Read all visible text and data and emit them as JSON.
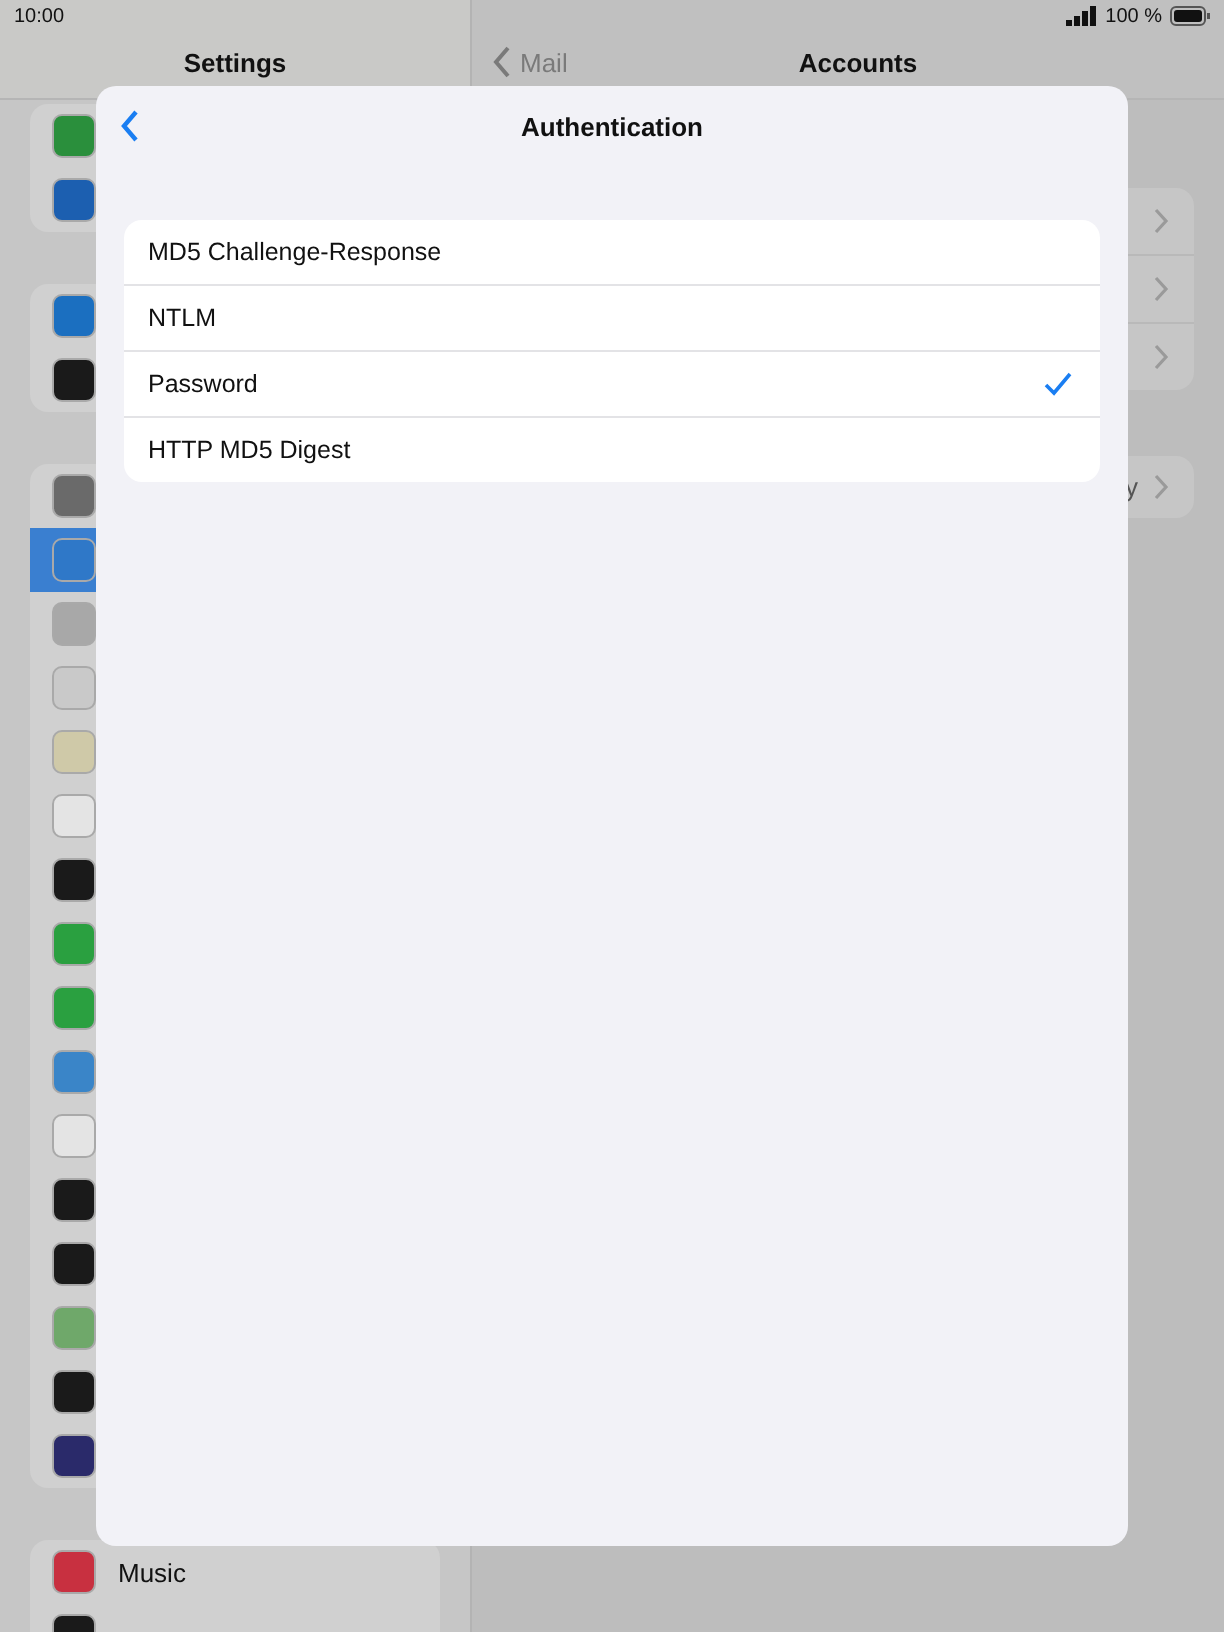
{
  "status_bar": {
    "time": "10:00",
    "battery": "100 %"
  },
  "sidebar": {
    "title": "Settings",
    "groups": [
      {
        "items": [
          {
            "selected": false
          },
          {
            "selected": false
          }
        ]
      },
      {
        "items": [
          {
            "selected": false
          },
          {
            "selected": false
          }
        ]
      },
      {
        "items": [
          {
            "selected": false
          },
          {
            "selected": true
          },
          {
            "selected": false
          },
          {
            "selected": false
          },
          {
            "selected": false
          },
          {
            "selected": false
          },
          {
            "selected": false
          },
          {
            "selected": false
          },
          {
            "selected": false
          },
          {
            "selected": false
          },
          {
            "selected": false
          },
          {
            "selected": false
          },
          {
            "selected": false
          },
          {
            "selected": false
          },
          {
            "selected": false
          },
          {
            "selected": false
          }
        ]
      },
      {
        "items": [
          {
            "label": "Music",
            "selected": false
          },
          {
            "selected": false
          }
        ]
      }
    ]
  },
  "detail": {
    "back": "Mail",
    "title": "Accounts",
    "groups": [
      {
        "rows": [
          {
            "kind": "link"
          },
          {
            "kind": "link"
          },
          {
            "kind": "link"
          }
        ]
      },
      {
        "rows": [
          {
            "kind": "link",
            "label": "y"
          }
        ]
      }
    ]
  },
  "sheet": {
    "title": "Authentication",
    "options": [
      {
        "label": "MD5 Challenge-Response",
        "selected": false
      },
      {
        "label": "NTLM",
        "selected": false
      },
      {
        "label": "Password",
        "selected": true
      },
      {
        "label": "HTTP MD5 Digest",
        "selected": false
      }
    ]
  }
}
